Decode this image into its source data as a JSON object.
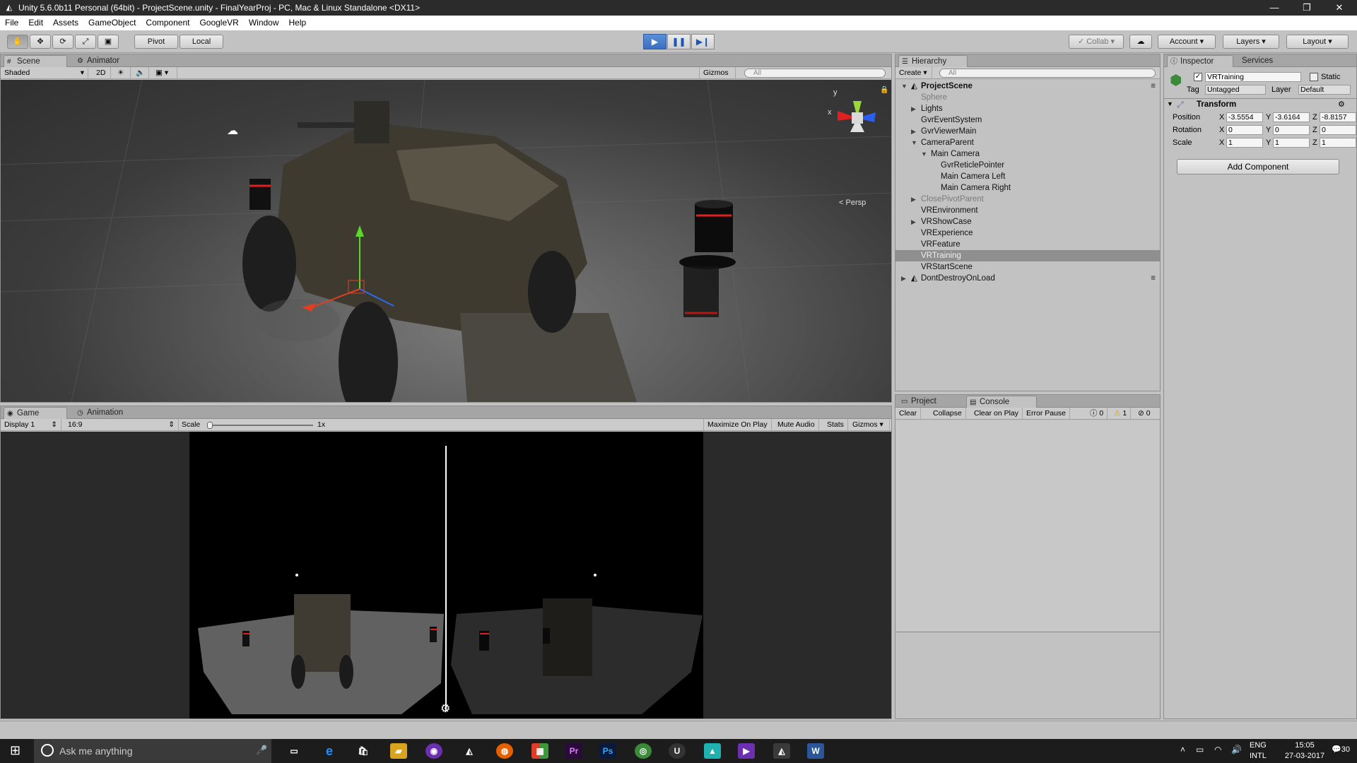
{
  "window": {
    "title": "Unity 5.6.0b11 Personal (64bit) - ProjectScene.unity - FinalYearProj - PC, Mac & Linux Standalone <DX11>",
    "minimize": "—",
    "maximize": "❐",
    "close": "✕"
  },
  "menu": [
    "File",
    "Edit",
    "Assets",
    "GameObject",
    "Component",
    "GoogleVR",
    "Window",
    "Help"
  ],
  "toolbar": {
    "pivot": "Pivot",
    "local": "Local",
    "collab": "Collab",
    "account": "Account",
    "layers": "Layers",
    "layout": "Layout"
  },
  "scene": {
    "tab_scene": "Scene",
    "tab_animator": "Animator",
    "shading": "Shaded",
    "mode2d": "2D",
    "gizmos": "Gizmos",
    "search_placeholder": "All",
    "persp": "Persp"
  },
  "game": {
    "tab_game": "Game",
    "tab_animation": "Animation",
    "display": "Display 1",
    "aspect": "16:9",
    "scale_label": "Scale",
    "scale_value": "1x",
    "maximize": "Maximize On Play",
    "mute": "Mute Audio",
    "stats": "Stats",
    "gizmos": "Gizmos"
  },
  "hierarchy": {
    "tab": "Hierarchy",
    "create": "Create",
    "search_placeholder": "All",
    "items": [
      {
        "label": "ProjectScene",
        "indent": 0,
        "arrow": "down",
        "bold": true,
        "scene": true
      },
      {
        "label": "Sphere",
        "indent": 1,
        "arrow": "",
        "grey": true
      },
      {
        "label": "Lights",
        "indent": 1,
        "arrow": "right"
      },
      {
        "label": "GvrEventSystem",
        "indent": 1,
        "arrow": ""
      },
      {
        "label": "GvrViewerMain",
        "indent": 1,
        "arrow": "right"
      },
      {
        "label": "CameraParent",
        "indent": 1,
        "arrow": "down"
      },
      {
        "label": "Main Camera",
        "indent": 2,
        "arrow": "down"
      },
      {
        "label": "GvrReticlePointer",
        "indent": 3,
        "arrow": ""
      },
      {
        "label": "Main Camera Left",
        "indent": 3,
        "arrow": ""
      },
      {
        "label": "Main Camera Right",
        "indent": 3,
        "arrow": ""
      },
      {
        "label": "ClosePivotParent",
        "indent": 1,
        "arrow": "right",
        "grey": true
      },
      {
        "label": "VREnvironment",
        "indent": 1,
        "arrow": ""
      },
      {
        "label": "VRShowCase",
        "indent": 1,
        "arrow": "right"
      },
      {
        "label": "VRExperience",
        "indent": 1,
        "arrow": ""
      },
      {
        "label": "VRFeature",
        "indent": 1,
        "arrow": ""
      },
      {
        "label": "VRTraining",
        "indent": 1,
        "arrow": "",
        "selected": true
      },
      {
        "label": "VRStartScene",
        "indent": 1,
        "arrow": ""
      },
      {
        "label": "DontDestroyOnLoad",
        "indent": 0,
        "arrow": "right",
        "scene": true
      }
    ]
  },
  "inspector": {
    "tab": "Inspector",
    "tab_services": "Services",
    "object_name": "VRTraining",
    "static": "Static",
    "tag_label": "Tag",
    "tag": "Untagged",
    "layer_label": "Layer",
    "layer": "Default",
    "transform": "Transform",
    "position": {
      "label": "Position",
      "x": "-3.5554",
      "y": "-3.6164",
      "z": "-8.8157"
    },
    "rotation": {
      "label": "Rotation",
      "x": "0",
      "y": "0",
      "z": "0"
    },
    "scale": {
      "label": "Scale",
      "x": "1",
      "y": "1",
      "z": "1"
    },
    "add_component": "Add Component",
    "axis_x": "X",
    "axis_y": "Y",
    "axis_z": "Z"
  },
  "console": {
    "tab_project": "Project",
    "tab_console": "Console",
    "clear": "Clear",
    "collapse": "Collapse",
    "clear_on_play": "Clear on Play",
    "error_pause": "Error Pause",
    "info_count": "0",
    "warn_count": "1",
    "error_count": "0"
  },
  "taskbar": {
    "search": "Ask me anything",
    "lang": "ENG",
    "region": "INTL",
    "time": "15:05",
    "date": "27-03-2017",
    "notif": "30"
  }
}
